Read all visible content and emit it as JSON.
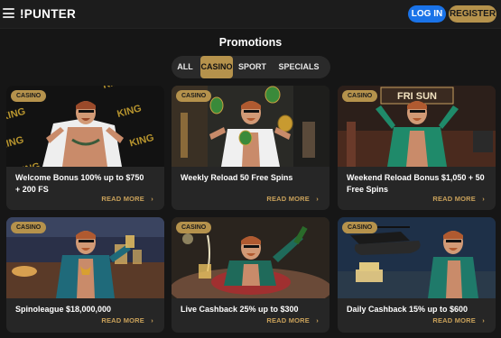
{
  "header": {
    "logo": "!PUNTER",
    "login_label": "LOG IN",
    "register_label": "REGISTER",
    "menu_icon": "hamburger-icon"
  },
  "page": {
    "title": "Promotions"
  },
  "tabs": [
    {
      "label": "ALL",
      "active": false
    },
    {
      "label": "CASINO",
      "active": true
    },
    {
      "label": "SPORT",
      "active": false
    },
    {
      "label": "SPECIALS",
      "active": false
    }
  ],
  "cards": [
    {
      "badge": "CASINO",
      "title_line1": "Welcome Bonus 100% up to $750",
      "title_line2": "+ 200 FS",
      "read_more": "READ MORE",
      "sign_text": "KING"
    },
    {
      "badge": "CASINO",
      "title_line1": "Weekly Reload 50 Free Spins",
      "title_line2": "",
      "read_more": "READ MORE",
      "sign_text": ""
    },
    {
      "badge": "CASINO",
      "title_line1": "Weekend Reload Bonus $1,050 + 50",
      "title_line2": "Free Spins",
      "read_more": "READ MORE",
      "sign_text": "FRI SUN"
    },
    {
      "badge": "CASINO",
      "title_line1": "Spinoleague $18,000,000",
      "title_line2": "",
      "read_more": "READ MORE",
      "sign_text": ""
    },
    {
      "badge": "CASINO",
      "title_line1": "Live Cashback 25% up to $300",
      "title_line2": "",
      "read_more": "READ MORE",
      "sign_text": ""
    },
    {
      "badge": "CASINO",
      "title_line1": "Daily Cashback 15% up to $600",
      "title_line2": "",
      "read_more": "READ MORE",
      "sign_text": ""
    }
  ],
  "colors": {
    "accent": "#b5924c",
    "login": "#1a73e8",
    "background": "#161616",
    "card": "#262626"
  }
}
